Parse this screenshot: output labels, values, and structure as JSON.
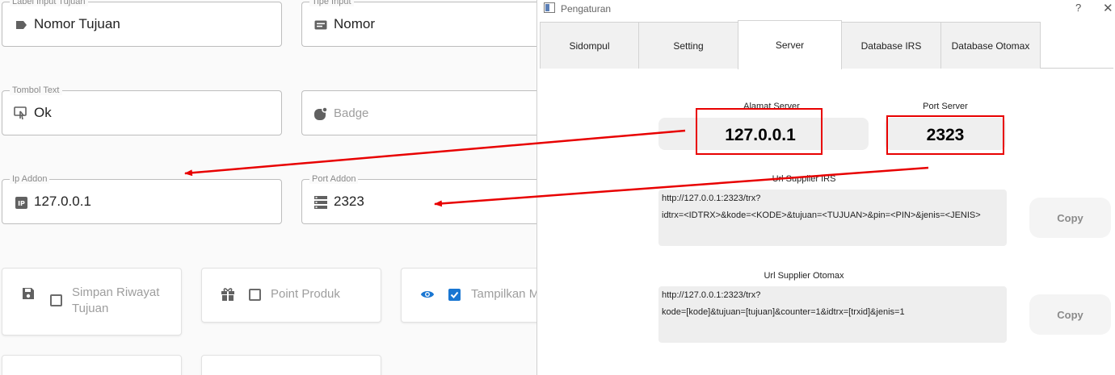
{
  "form": {
    "label_input_tujuan": {
      "label": "Label Input Tujuan",
      "value": "Nomor Tujuan",
      "icon": "label-icon"
    },
    "tipe_input": {
      "label": "Tipe Input",
      "value": "Nomor",
      "icon": "text-fields-icon"
    },
    "tombol_text": {
      "label": "Tombol Text",
      "value": "Ok",
      "icon": "touch-app-icon"
    },
    "badge": {
      "placeholder": "Badge",
      "icon": "badge-icon"
    },
    "ip_addon": {
      "label": "Ip Addon",
      "value": "127.0.0.1",
      "icon": "ip-icon"
    },
    "port_addon": {
      "label": "Port Addon",
      "value": "2323",
      "icon": "storage-icon"
    },
    "cards": {
      "simpan_riwayat": {
        "label_line1": "Simpan Riwayat",
        "label_line2": "Tujuan",
        "checked": false
      },
      "point_produk": {
        "label": "Point Produk",
        "checked": false
      },
      "tampilkan": {
        "label": "Tampilkan M",
        "checked": true
      }
    }
  },
  "dialog": {
    "title": "Pengaturan",
    "help": "?",
    "close": "✕",
    "tabs": [
      "Sidompul",
      "Setting",
      "Server",
      "Database IRS",
      "Database Otomax"
    ],
    "active_tab": "Server",
    "server": {
      "alamat_label": "Alamat Server",
      "alamat_value": "127.0.0.1",
      "port_label": "Port Server",
      "port_value": "2323",
      "irs_label": "Url Supplier IRS",
      "irs_line1": "http://127.0.0.1:2323/trx?",
      "irs_line2": "idtrx=<IDTRX>&kode=<KODE>&tujuan=<TUJUAN>&pin=<PIN>&jenis=<JENIS>",
      "otomax_label": "Url Supplier Otomax",
      "otomax_line1": "http://127.0.0.1:2323/trx?",
      "otomax_line2": "kode=[kode]&tujuan=[tujuan]&counter=1&idtrx=[trxid]&jenis=1",
      "copy_label": "Copy"
    }
  },
  "colors": {
    "accent": "#1976d2",
    "annotation": "#e80000",
    "icon_grey": "#616161"
  }
}
